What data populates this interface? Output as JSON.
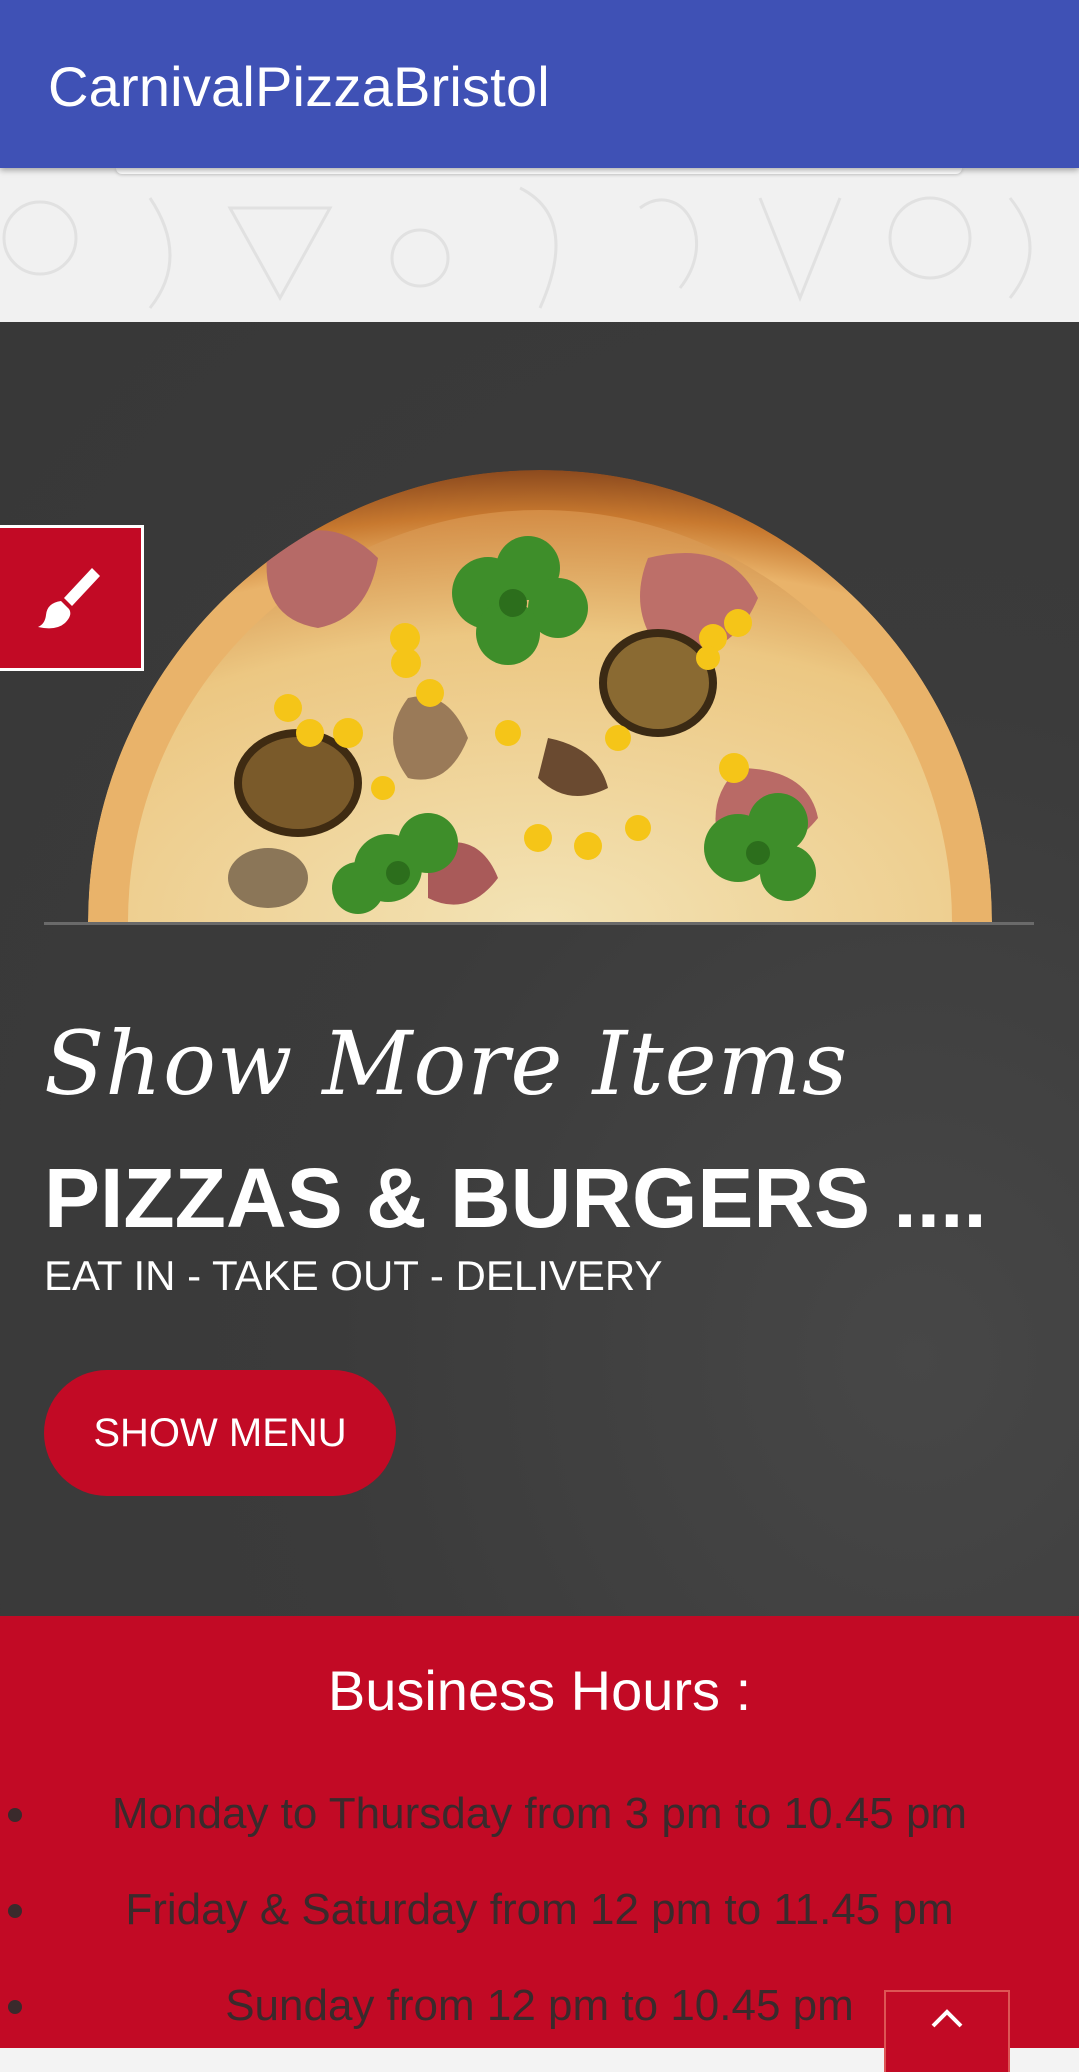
{
  "app_bar": {
    "title": "CarnivalPizzaBristol"
  },
  "hero": {
    "script_title": "Show More Items",
    "heading": "PIZZAS & BURGERS ....",
    "subheading": "EAT IN - TAKE OUT - DELIVERY",
    "show_menu_label": "SHOW MENU",
    "theme_button_icon": "paintbrush-icon",
    "image_icon": "pizza-image"
  },
  "business_hours": {
    "title": "Business Hours :",
    "items": [
      "Monday to Thursday from 3 pm to 10.45 pm",
      "Friday & Saturday from 12 pm to 11.45 pm",
      "Sunday from 12 pm to 10.45 pm"
    ]
  },
  "scroll_top_icon": "chevron-up-icon",
  "colors": {
    "app_bar": "#3f51b5",
    "accent_red": "#c20a25",
    "hero_bg": "#3b3b3b"
  }
}
